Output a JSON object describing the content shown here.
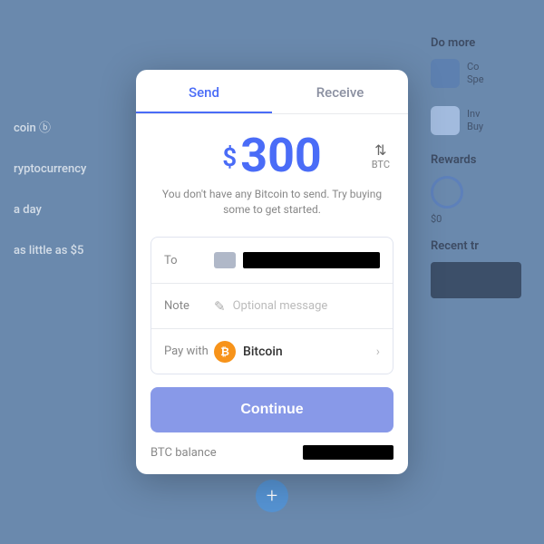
{
  "background": {
    "left_items": [
      "coin",
      "ryptocurrency",
      "a day",
      "as little as $5"
    ],
    "right_title": "Do more",
    "right_items": [
      {
        "label": "Co",
        "sublabel": "Spe"
      },
      {
        "label": "Inv",
        "sublabel": "Buy"
      }
    ],
    "rewards_title": "Rewards",
    "rewards_amount": "$0",
    "recent_title": "Recent tr",
    "plus_label": "+"
  },
  "modal": {
    "tabs": [
      {
        "label": "Send",
        "active": true
      },
      {
        "label": "Receive",
        "active": false
      }
    ],
    "amount": {
      "currency_symbol": "$",
      "value": "300",
      "btc_toggle_label": "BTC"
    },
    "hint_text": "You don't have any Bitcoin to send. Try buying some to get started.",
    "fields": {
      "to_label": "To",
      "note_label": "Note",
      "note_placeholder": "Optional message",
      "pay_with_label": "Pay with",
      "pay_with_value": "Bitcoin"
    },
    "continue_button": "Continue",
    "btc_balance_label": "BTC balance"
  }
}
